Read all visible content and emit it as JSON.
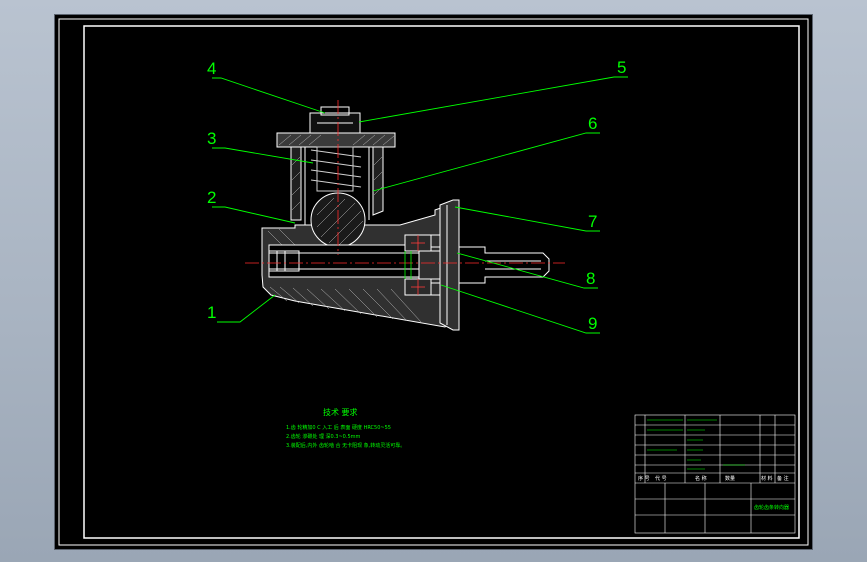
{
  "drawing": {
    "background": "#000000",
    "line_color": "#ffffff",
    "label_color": "#00ff00",
    "centerline_color": "#ff0000",
    "callouts": [
      "1",
      "2",
      "3",
      "4",
      "5",
      "6",
      "7",
      "8",
      "9"
    ],
    "notes": {
      "title": "技术 要求",
      "lines": [
        "1.齿 轮精加0 C  入工  后   表面 硬度 HRC50~55",
        "2.齿轮  渗碳处 理   深0.3~0.5mm",
        "3.装配后,内外 齿轮啮 合   无卡阻现 象,转动灵活可靠。"
      ]
    },
    "title_block": {
      "title_text": "齿轮齿条转向器",
      "row_texts": [
        "序 号",
        "代 号",
        "名 称",
        "数量",
        "材 料",
        "备 注"
      ]
    }
  }
}
